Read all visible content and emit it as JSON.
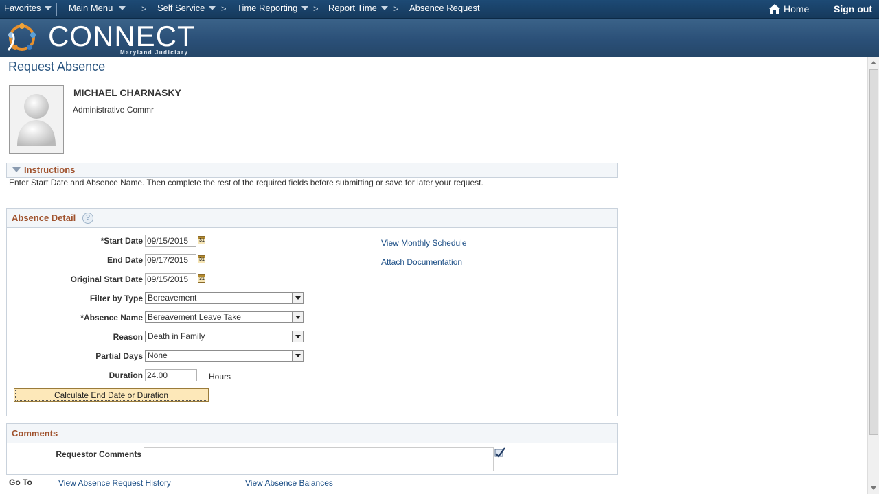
{
  "nav": {
    "favorites": "Favorites",
    "main_menu": "Main Menu",
    "self_service": "Self Service",
    "time_reporting": "Time Reporting",
    "report_time": "Report Time",
    "absence_request": "Absence Request",
    "home": "Home",
    "sign_out": "Sign out",
    "separator": ">"
  },
  "brand": {
    "title": "CONNECT",
    "subtitle": "Maryland Judiciary"
  },
  "page_title": "Request Absence",
  "employee": {
    "name": "MICHAEL CHARNASKY",
    "title": "Administrative Commr"
  },
  "instructions": {
    "header": "Instructions",
    "text": "Enter Start Date and Absence Name. Then complete the rest of the required fields before submitting or save for later your request."
  },
  "absence_detail": {
    "header": "Absence Detail",
    "help": "?",
    "start_date_label": "*Start Date",
    "start_date": "09/15/2015",
    "end_date_label": "End Date",
    "end_date": "09/17/2015",
    "original_start_label": "Original Start Date",
    "original_start": "09/15/2015",
    "filter_type_label": "Filter by Type",
    "filter_type": "Bereavement",
    "absence_name_label": "*Absence Name",
    "absence_name": "Bereavement Leave Take",
    "reason_label": "Reason",
    "reason": "Death in Family",
    "partial_days_label": "Partial Days",
    "partial_days": "None",
    "duration_label": "Duration",
    "duration": "24.00",
    "duration_unit": "Hours",
    "calc_button": "Calculate End Date or Duration",
    "view_schedule": "View Monthly Schedule",
    "attach_doc": "Attach Documentation",
    "cal_glyph": "31"
  },
  "comments": {
    "header": "Comments",
    "requestor_label": "Requestor Comments",
    "requestor_value": ""
  },
  "goto": {
    "label": "Go To",
    "history": "View Absence Request History",
    "balances": "View Absence Balances"
  }
}
